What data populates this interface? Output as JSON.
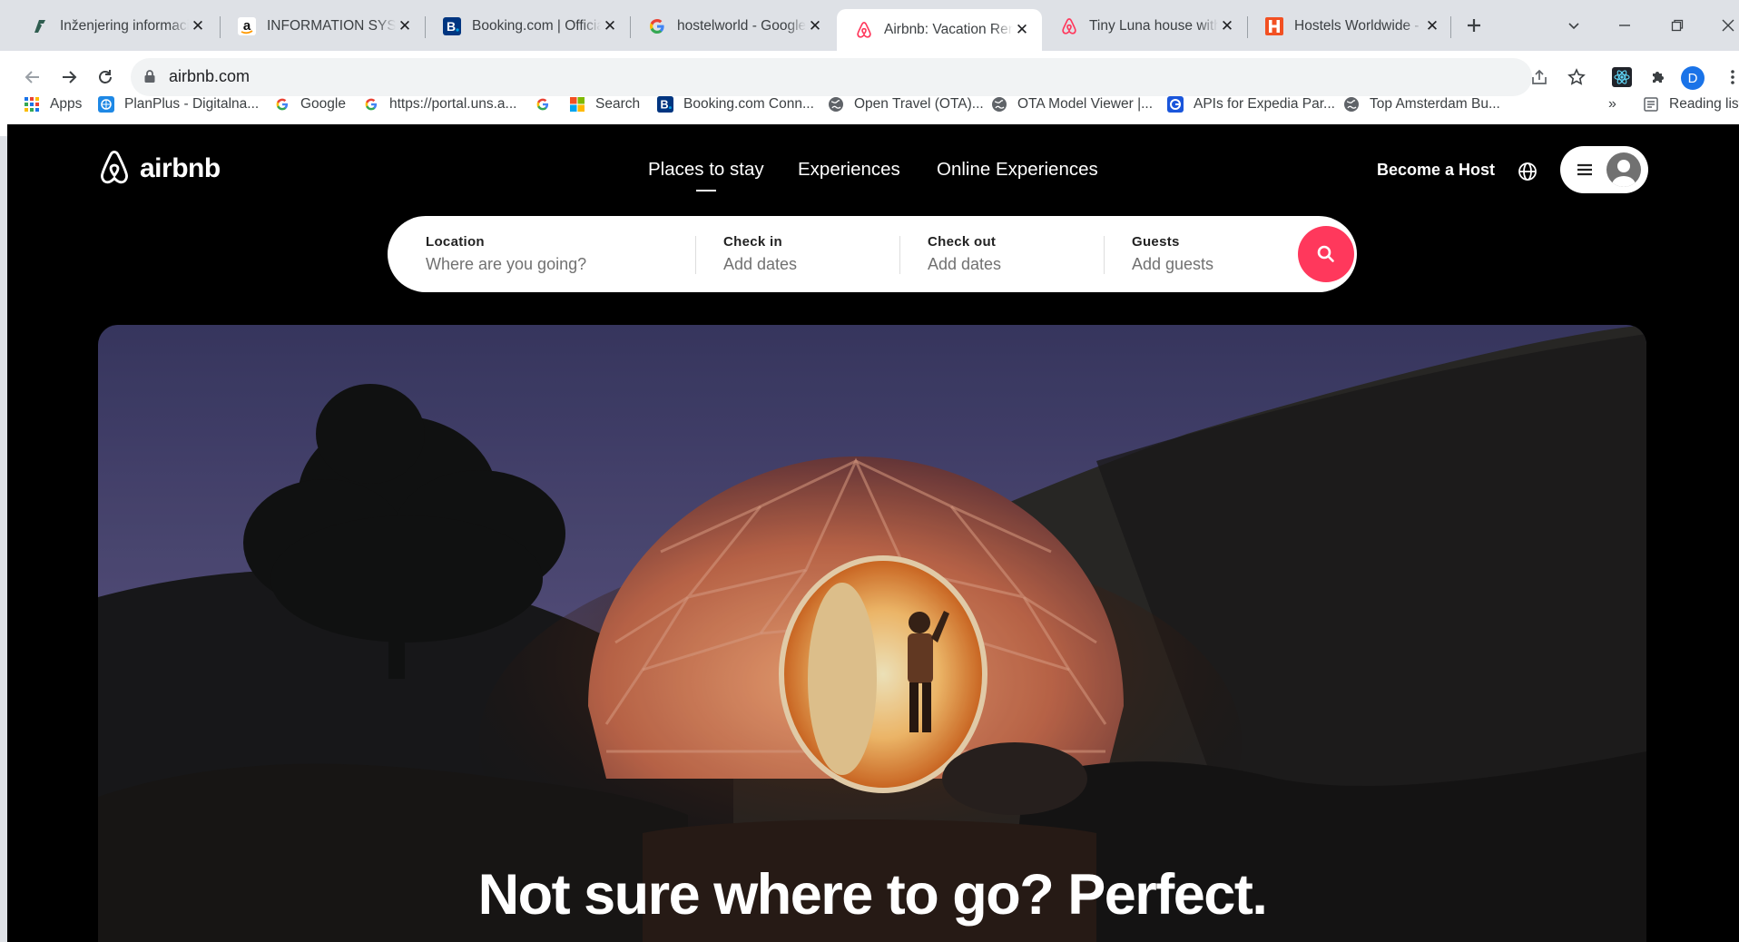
{
  "browser": {
    "tabs": [
      {
        "title": "Inženjering informacionih",
        "icon": "ftn-favicon-icon"
      },
      {
        "title": "INFORMATION SYSTEMS",
        "icon": "amazon-favicon-icon"
      },
      {
        "title": "Booking.com | Official site",
        "icon": "booking-favicon-icon"
      },
      {
        "title": "hostelworld - Google Search",
        "icon": "google-favicon-icon"
      },
      {
        "title": "Airbnb: Vacation Rentals",
        "icon": "airbnb-favicon-icon",
        "active": true
      },
      {
        "title": "Tiny Luna house with",
        "icon": "airbnb-favicon-icon"
      },
      {
        "title": "Hostels Worldwide - Online",
        "icon": "hostelworld-favicon-icon"
      }
    ],
    "url": "airbnb.com",
    "profile_initial": "D",
    "bookmarks": [
      {
        "label": "Apps"
      },
      {
        "label": "PlanPlus - Digitalna..."
      },
      {
        "label": "Google"
      },
      {
        "label": "https://portal.uns.a..."
      },
      {
        "label": ""
      },
      {
        "label": "Search"
      },
      {
        "label": "Booking.com Conn..."
      },
      {
        "label": "Open Travel (OTA)..."
      },
      {
        "label": "OTA Model Viewer |..."
      },
      {
        "label": "APIs for Expedia Par..."
      },
      {
        "label": "Top Amsterdam Bu..."
      }
    ],
    "bookmarks_overflow": "»",
    "reading_list": "Reading list"
  },
  "site": {
    "brand": "airbnb",
    "brand_color": "#ff385c",
    "nav": [
      "Places to stay",
      "Experiences",
      "Online Experiences"
    ],
    "become_host": "Become a Host",
    "search": {
      "location_label": "Location",
      "location_placeholder": "Where are you going?",
      "checkin_label": "Check in",
      "checkin_value": "Add dates",
      "checkout_label": "Check out",
      "checkout_value": "Add dates",
      "guests_label": "Guests",
      "guests_value": "Add guests"
    },
    "hero_headline": "Not sure where to go? Perfect."
  }
}
